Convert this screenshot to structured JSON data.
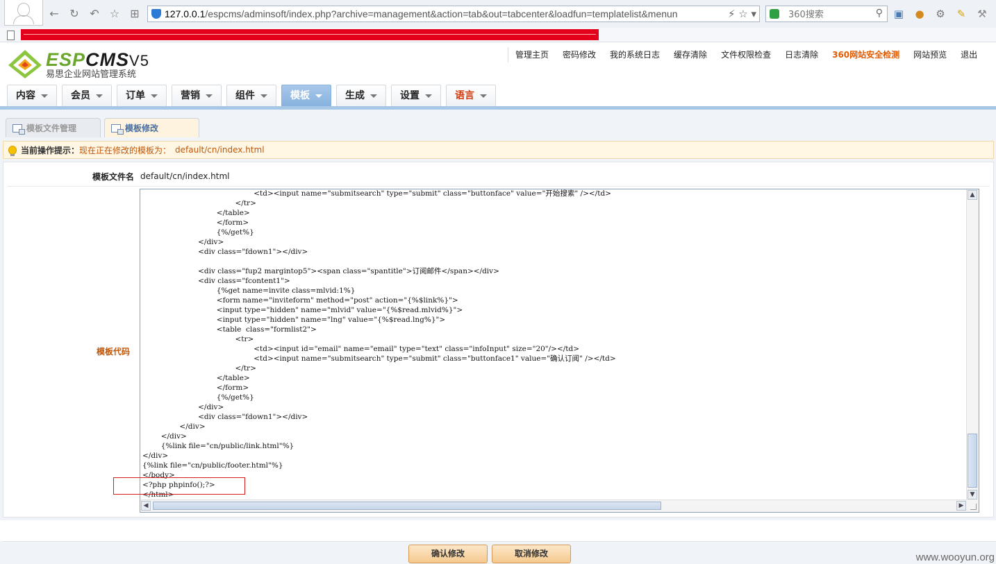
{
  "browser": {
    "url_host": "127.0.0.1",
    "url_rest": "/espcms/adminsoft/index.php?archive=management&action=tab&out=tabcenter&loadfun=templatelist&menun",
    "search_placeholder": "360搜索",
    "accent": "#2b7bd6"
  },
  "app": {
    "logo_esp": "ESP",
    "logo_cms": "CMS",
    "logo_ver": "V5",
    "logo_subtitle": "易思企业网站管理系统",
    "top_links": [
      "管理主页",
      "密码修改",
      "我的系统日志",
      "缓存清除",
      "文件权限检查",
      "日志清除",
      "360网站安全检测",
      "网站预览",
      "退出"
    ],
    "nav": [
      "内容",
      "会员",
      "订单",
      "营销",
      "组件",
      "模板",
      "生成",
      "设置",
      "语言"
    ],
    "nav_active": "模板"
  },
  "subtabs": [
    "模板文件管理",
    "模板修改"
  ],
  "hint": {
    "label": "当前操作提示：",
    "message": "现在正在修改的模板为：",
    "path": "default/cn/index.html"
  },
  "form": {
    "file_label": "模板文件名",
    "file_value": "default/cn/index.html",
    "code_label": "模板代码"
  },
  "code_lines": [
    "                                                <td><input name=\"submitsearch\" type=\"submit\" class=\"buttonface\" value=\"开始搜索\" /></td>",
    "                                        </tr>",
    "                                </table>",
    "                                </form>",
    "                                {%/get%}",
    "                        </div>",
    "                        <div class=\"fdown1\"></div>",
    "",
    "                        <div class=\"fup2 margintop5\"><span class=\"spantitle\">订阅邮件</span></div>",
    "                        <div class=\"fcontent1\">",
    "                                {%get name=invite class=mlvid:1%}",
    "                                <form name=\"inviteform\" method=\"post\" action=\"{%$link%}\">",
    "                                <input type=\"hidden\" name=\"mlvid\" value=\"{%$read.mlvid%}\">",
    "                                <input type=\"hidden\" name=\"lng\" value=\"{%$read.lng%}\">",
    "                                <table  class=\"formlist2\">",
    "                                        <tr>",
    "                                                <td><input id=\"email\" name=\"email\" type=\"text\" class=\"infoInput\" size=\"20\"/></td>",
    "                                                <td><input name=\"submitsearch\" type=\"submit\" class=\"buttonface1\" value=\"确认订阅\" /></td>",
    "                                        </tr>",
    "                                </table>",
    "                                </form>",
    "                                {%/get%}",
    "                        </div>",
    "                        <div class=\"fdown1\"></div>",
    "                </div>",
    "        </div>",
    "        {%link file=\"cn/public/link.html\"%}",
    "</div>",
    "{%link file=\"cn/public/footer.html\"%}",
    "</body>",
    "<?php phpinfo();?>",
    "</html>"
  ],
  "buttons": {
    "confirm": "确认修改",
    "cancel": "取消修改"
  },
  "watermark": "www.wooyun.org"
}
